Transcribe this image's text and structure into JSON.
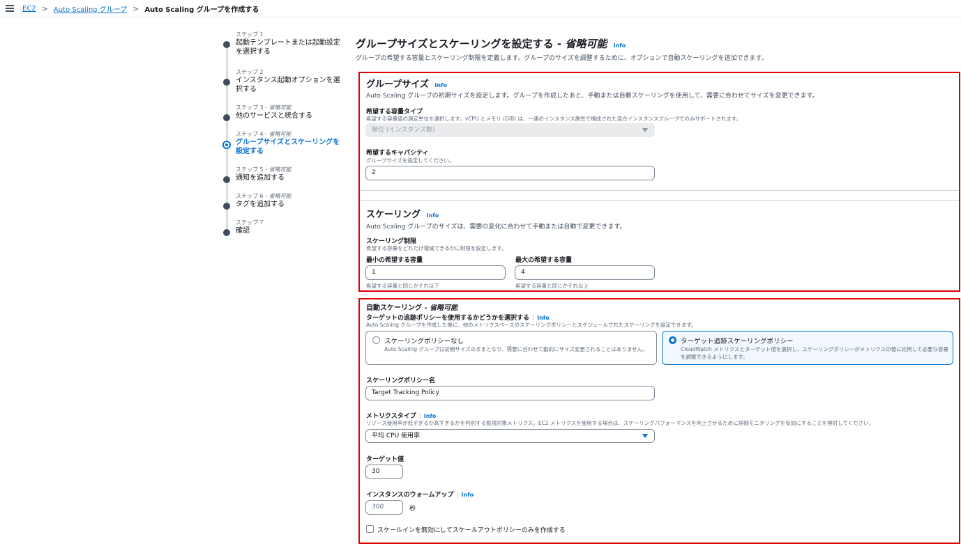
{
  "breadcrumb": {
    "items": [
      "EC2",
      "Auto Scaling グループ"
    ],
    "current": "Auto Scaling グループを作成する"
  },
  "steps": [
    {
      "label": "ステップ 1",
      "optional": "",
      "title": "起動テンプレートまたは起動設定を選択する"
    },
    {
      "label": "ステップ 2",
      "optional": "",
      "title": "インスタンス起動オプションを選択する"
    },
    {
      "label": "ステップ 3 - ",
      "optional": "省略可能",
      "title": "他のサービスと統合する"
    },
    {
      "label": "ステップ 4 - ",
      "optional": "省略可能",
      "title": "グループサイズとスケーリングを設定する"
    },
    {
      "label": "ステップ 5 - ",
      "optional": "省略可能",
      "title": "通知を追加する"
    },
    {
      "label": "ステップ 6 - ",
      "optional": "省略可能",
      "title": "タグを追加する"
    },
    {
      "label": "ステップ 7",
      "optional": "",
      "title": "確認"
    }
  ],
  "active_step": 4,
  "page": {
    "title": "グループサイズとスケーリングを設定する - ",
    "title_optional": "省略可能",
    "info": "Info",
    "description": "グループの希望する容量とスケーリング制限を定義します。グループのサイズを調整するために、オプションで自動スケーリングを追加できます。"
  },
  "group_size": {
    "title": "グループサイズ",
    "info": "Info",
    "description": "Auto Scaling グループの初期サイズを設定します。グループを作成したあと、手動または自動スケーリングを使用して、需要に合わせてサイズを変更できます。",
    "capacity_type_label": "希望する容量タイプ",
    "capacity_type_hint": "希望する容量値の測定単位を選択します。vCPU とメモリ (GiB) は、一連のインスタンス属性で構成された混合インスタンスグループでのみサポートされます。",
    "capacity_type_value": "単位 (インスタンス数)",
    "desired_capacity_label": "希望するキャパシティ",
    "desired_capacity_hint": "グループサイズを指定してください。",
    "desired_capacity_value": "2"
  },
  "scaling": {
    "title": "スケーリング",
    "info": "Info",
    "description": "Auto Scaling グループのサイズは、需要の変化に合わせて手動または自動で変更できます。",
    "limits_label": "スケーリング制限",
    "limits_hint": "希望する容量をどれだけ増減できるかに制限を設定します。",
    "min_label": "最小の希望する容量",
    "min_value": "1",
    "min_hint": "希望する容量と同じかそれ以下",
    "max_label": "最大の希望する容量",
    "max_value": "4",
    "max_hint": "希望する容量と同じかそれ以上"
  },
  "auto_scaling": {
    "title": "自動スケーリング - ",
    "title_optional": "省略可能",
    "policy_choice_label": "ターゲットの追跡ポリシーを使用するかどうかを選択する",
    "info": "Info",
    "policy_choice_hint": "Auto Scaling グループを作成した後に、他のメトリクスベースのスケーリングポリシーとスケジュールされたスケーリングを設定できます。",
    "option_none_title": "スケーリングポリシーなし",
    "option_none_desc": "Auto Scaling グループは初期サイズのままとなり、需要に合わせて動的にサイズ変更されることはありません。",
    "option_target_title": "ターゲット追跡スケーリングポリシー",
    "option_target_desc": "CloudWatch メトリクスとターゲット値を選択し、スケーリングポリシーがメトリクスの値に比例して必要な容量を調整できるようにします。",
    "policy_name_label": "スケーリングポリシー名",
    "policy_name_value": "Target Tracking Policy",
    "metric_type_label": "メトリクスタイプ",
    "metric_type_hint": "リソース使用率が低すぎるか高すぎるかを判別する監視対象メトリクス。EC2 メトリクスを使用する場合は、スケーリングパフォーマンスを向上させるために詳細モニタリングを有効にすることを検討してください。",
    "metric_type_value": "平均 CPU 使用率",
    "target_value_label": "ターゲット値",
    "target_value": "30",
    "warmup_label": "インスタンスのウォームアップ",
    "warmup_placeholder": "300",
    "warmup_unit": "秒",
    "scale_in_checkbox_label": "スケールインを無効にしてスケールアウトポリシーのみを作成する"
  },
  "colors": {
    "accent": "#0972d3",
    "highlight_border": "#e00000"
  }
}
